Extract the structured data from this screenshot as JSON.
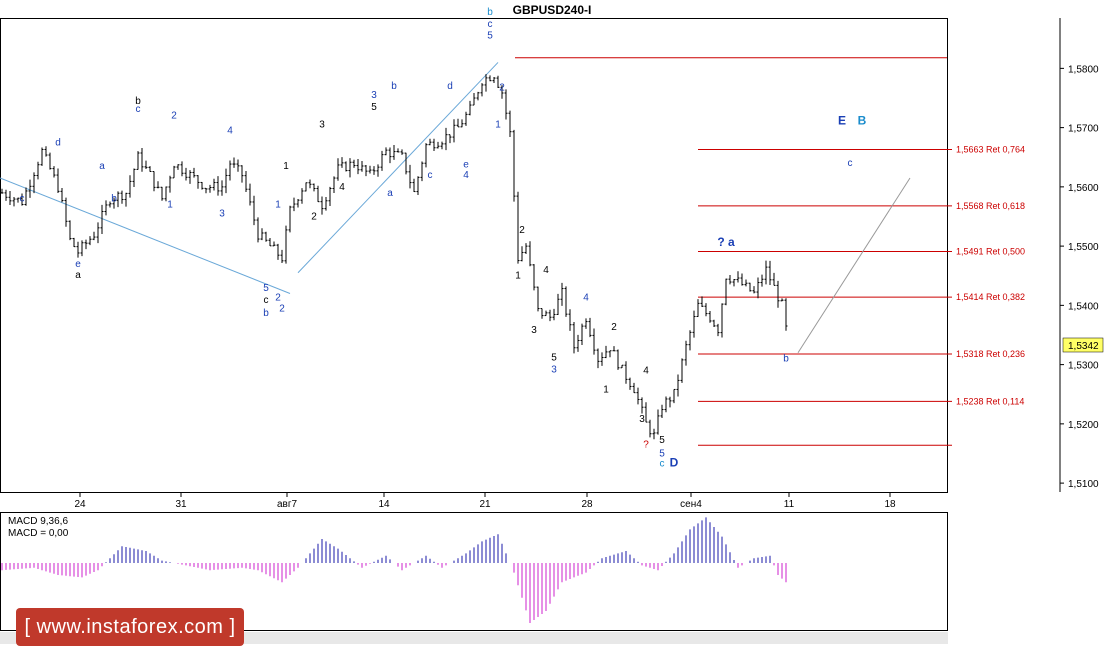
{
  "chart_data": {
    "type": "candlestick",
    "symbol": "GBPUSD240-I",
    "current_price": "1,5342",
    "y_range": [
      1.5085,
      1.5885
    ],
    "y_ticks": [
      "1,5800",
      "1,5700",
      "1,5600",
      "1,5500",
      "1,5400",
      "1,5300",
      "1,5200",
      "1,5100"
    ],
    "x_ticks": [
      "24",
      "31",
      "авг7",
      "14",
      "21",
      "28",
      "сен4",
      "11",
      "18"
    ],
    "fib_levels": [
      {
        "value": 1.5818,
        "label": ""
      },
      {
        "value": 1.5663,
        "label": "1,5663 Ret 0,764"
      },
      {
        "value": 1.5568,
        "label": "1,5568 Ret 0,618"
      },
      {
        "value": 1.5491,
        "label": "1,5491 Ret 0,500"
      },
      {
        "value": 1.5414,
        "label": "1,5414 Ret 0,382"
      },
      {
        "value": 1.5318,
        "label": "1,5318 Ret 0,236"
      },
      {
        "value": 1.5238,
        "label": "1,5238 Ret 0,114"
      },
      {
        "value": 1.5164,
        "label": ""
      }
    ],
    "wave_labels": [
      {
        "t": "d",
        "price": 1.567,
        "bar": 14,
        "c": "#1a3fb5"
      },
      {
        "t": "c",
        "price": 1.5575,
        "bar": 5,
        "c": "#1a3fb5"
      },
      {
        "t": "e",
        "price": 1.5465,
        "bar": 19,
        "c": "#1a3fb5"
      },
      {
        "t": "a",
        "price": 1.5446,
        "bar": 19,
        "c": "#000"
      },
      {
        "t": "a",
        "price": 1.563,
        "bar": 25,
        "c": "#1a3fb5"
      },
      {
        "t": "b",
        "price": 1.5575,
        "bar": 28,
        "c": "#1a3fb5"
      },
      {
        "t": "b",
        "price": 1.574,
        "bar": 34,
        "c": "#000"
      },
      {
        "t": "c",
        "price": 1.5726,
        "bar": 34,
        "c": "#1a3fb5"
      },
      {
        "t": "2",
        "price": 1.5715,
        "bar": 43,
        "c": "#1a3fb5"
      },
      {
        "t": "1",
        "price": 1.5565,
        "bar": 42,
        "c": "#1a3fb5"
      },
      {
        "t": "4",
        "price": 1.569,
        "bar": 57,
        "c": "#1a3fb5"
      },
      {
        "t": "3",
        "price": 1.555,
        "bar": 55,
        "c": "#1a3fb5"
      },
      {
        "t": "1",
        "price": 1.5565,
        "bar": 69,
        "c": "#1a3fb5"
      },
      {
        "t": "2",
        "price": 1.5408,
        "bar": 69,
        "c": "#1a3fb5"
      },
      {
        "t": "5",
        "price": 1.5424,
        "bar": 66,
        "c": "#1a3fb5"
      },
      {
        "t": "c",
        "price": 1.5404,
        "bar": 66,
        "c": "#000"
      },
      {
        "t": "b",
        "price": 1.5382,
        "bar": 66,
        "c": "#1a3fb5"
      },
      {
        "t": "2",
        "price": 1.539,
        "bar": 70,
        "c": "#1a3fb5"
      },
      {
        "t": "1",
        "price": 1.563,
        "bar": 71,
        "c": "#000"
      },
      {
        "t": "2",
        "price": 1.5545,
        "bar": 78,
        "c": "#000"
      },
      {
        "t": "3",
        "price": 1.57,
        "bar": 80,
        "c": "#000"
      },
      {
        "t": "4",
        "price": 1.5595,
        "bar": 85,
        "c": "#000"
      },
      {
        "t": "3",
        "price": 1.575,
        "bar": 93,
        "c": "#1a3fb5"
      },
      {
        "t": "5",
        "price": 1.573,
        "bar": 93,
        "c": "#000"
      },
      {
        "t": "a",
        "price": 1.5585,
        "bar": 97,
        "c": "#1a3fb5"
      },
      {
        "t": "b",
        "price": 1.5765,
        "bar": 98,
        "c": "#1a3fb5"
      },
      {
        "t": "c",
        "price": 1.5615,
        "bar": 107,
        "c": "#1a3fb5"
      },
      {
        "t": "d",
        "price": 1.5765,
        "bar": 112,
        "c": "#1a3fb5"
      },
      {
        "t": "e",
        "price": 1.5633,
        "bar": 116,
        "c": "#1a3fb5"
      },
      {
        "t": "4",
        "price": 1.5615,
        "bar": 116,
        "c": "#1a3fb5"
      },
      {
        "t": "b",
        "price": 1.589,
        "bar": 122,
        "c": "#1a8ccc"
      },
      {
        "t": "c",
        "price": 1.587,
        "bar": 122,
        "c": "#1a3fb5"
      },
      {
        "t": "5",
        "price": 1.585,
        "bar": 122,
        "c": "#1a3fb5"
      },
      {
        "t": "2",
        "price": 1.5763,
        "bar": 125,
        "c": "#1a3fb5"
      },
      {
        "t": "1",
        "price": 1.57,
        "bar": 124,
        "c": "#1a3fb5"
      },
      {
        "t": "2",
        "price": 1.5522,
        "bar": 130,
        "c": "#000"
      },
      {
        "t": "1",
        "price": 1.5445,
        "bar": 129,
        "c": "#000"
      },
      {
        "t": "4",
        "price": 1.5455,
        "bar": 136,
        "c": "#000"
      },
      {
        "t": "3",
        "price": 1.5353,
        "bar": 133,
        "c": "#000"
      },
      {
        "t": "5",
        "price": 1.5307,
        "bar": 138,
        "c": "#000"
      },
      {
        "t": "3",
        "price": 1.5287,
        "bar": 138,
        "c": "#1a3fb5"
      },
      {
        "t": "4",
        "price": 1.5408,
        "bar": 146,
        "c": "#1a3fb5"
      },
      {
        "t": "2",
        "price": 1.5358,
        "bar": 153,
        "c": "#000"
      },
      {
        "t": "1",
        "price": 1.5253,
        "bar": 151,
        "c": "#000"
      },
      {
        "t": "4",
        "price": 1.5285,
        "bar": 161,
        "c": "#000"
      },
      {
        "t": "3",
        "price": 1.5203,
        "bar": 160,
        "c": "#000"
      },
      {
        "t": "?",
        "price": 1.516,
        "bar": 161,
        "c": "#cc0000"
      },
      {
        "t": "5",
        "price": 1.5168,
        "bar": 165,
        "c": "#000"
      },
      {
        "t": "5",
        "price": 1.5145,
        "bar": 165,
        "c": "#1a3fb5"
      },
      {
        "t": "c",
        "price": 1.5128,
        "bar": 165,
        "c": "#1a8ccc"
      },
      {
        "t": "D",
        "price": 1.5128,
        "bar": 168,
        "c": "#1a3fb5"
      },
      {
        "t": "? a",
        "price": 1.55,
        "bar": 181,
        "c": "#1a3fb5"
      },
      {
        "t": "b",
        "price": 1.5305,
        "bar": 196,
        "c": "#1a3fb5"
      },
      {
        "t": "c",
        "price": 1.5635,
        "bar": 212,
        "c": "#1a3fb5"
      },
      {
        "t": "E",
        "price": 1.5705,
        "bar": 210,
        "c": "#1a3fb5"
      },
      {
        "t": "B",
        "price": 1.5705,
        "bar": 215,
        "c": "#1a8ccc"
      }
    ],
    "indicator": {
      "name": "MACD 9,36,6",
      "value_label": "MACD = 0,00",
      "pos_color": "#1a1aa8",
      "neg_color": "#cc22cc"
    },
    "colors": {
      "fib": "#cc0000",
      "trendline": "#6aa8d8",
      "projection": "#999999"
    }
  },
  "watermark_text": "[ www.instaforex.com ]"
}
